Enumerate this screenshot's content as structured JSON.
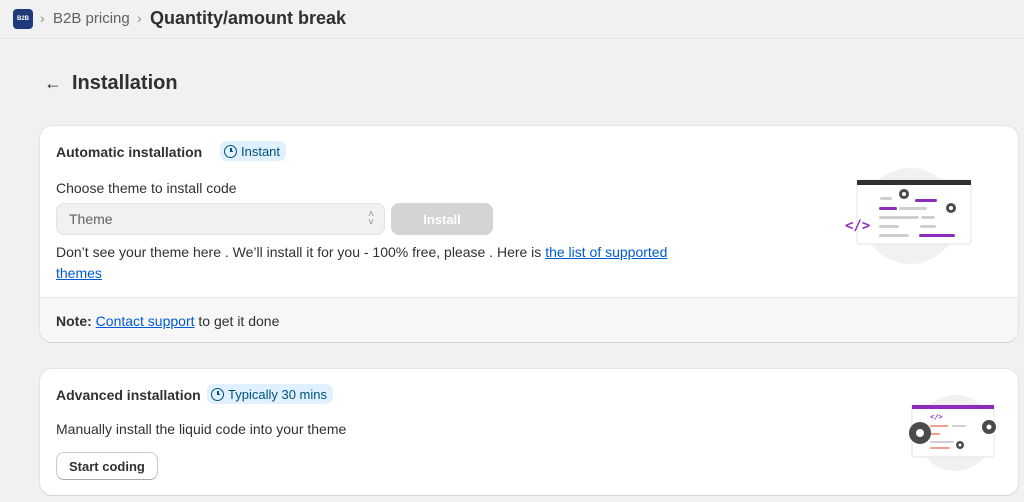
{
  "breadcrumb": {
    "logo_text": "B2B",
    "separator": "›",
    "app_name": "B2B pricing",
    "current": "Quantity/amount break"
  },
  "header": {
    "back_arrow": "←",
    "title": "Installation"
  },
  "automatic": {
    "title": "Automatic installation",
    "badge": "Instant",
    "choose_label": "Choose theme to install code",
    "select_value": "Theme",
    "install_label": "Install",
    "help_text": "Don’t see your theme here . We’ll install it for you - 100% free, please . Here is ",
    "help_link": "the list of supported themes",
    "note_label": "Note:",
    "note_link": "Contact support",
    "note_text": " to get it done"
  },
  "advanced": {
    "title": "Advanced installation",
    "badge": "Typically 30 mins",
    "description": "Manually install the liquid code into your theme",
    "start_label": "Start coding"
  },
  "colors": {
    "accent_purple": "#8c2bbd",
    "link_blue": "#005bd3",
    "badge_bg": "#e0f0ff",
    "badge_text": "#00527c",
    "disabled_button": "#d4d4d4"
  },
  "icons": {
    "back": "arrow-left-icon",
    "clock": "clock-icon",
    "gear": "gear-icon",
    "code": "code-icon",
    "select": "chevron-up-down-icon"
  }
}
